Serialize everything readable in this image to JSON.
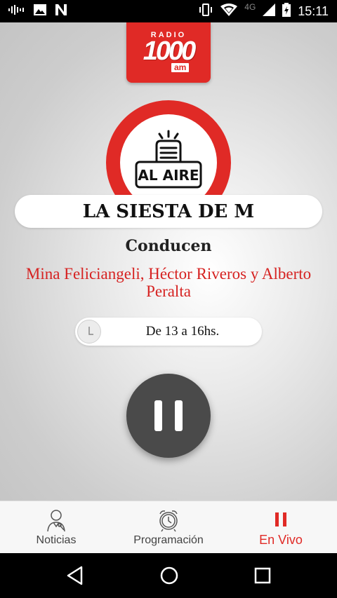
{
  "status_bar": {
    "time": "15:11",
    "network": "4G",
    "icons": [
      "equalizer-icon",
      "image-icon",
      "n-app-icon",
      "vibrate-icon",
      "wifi-icon",
      "signal-icon",
      "battery-charging-icon"
    ]
  },
  "logo": {
    "radio": "RADIO",
    "number": "1000",
    "band": "am"
  },
  "onair": {
    "label": "AL AIRE"
  },
  "program": {
    "title": "LA SIESTA DE M",
    "conducen_label": "Conducen",
    "hosts": "Mina Feliciangeli, Héctor Riveros y Alberto Peralta",
    "schedule": "De 13 a 16hs."
  },
  "player": {
    "state": "playing",
    "control_icon": "pause-icon"
  },
  "bottom_nav": {
    "items": [
      {
        "label": "Noticias",
        "icon": "reporter-icon",
        "active": false
      },
      {
        "label": "Programación",
        "icon": "alarm-clock-icon",
        "active": false
      },
      {
        "label": "En Vivo",
        "icon": "pause-icon",
        "active": true
      }
    ]
  },
  "colors": {
    "brand_red": "#e02a26",
    "player_dark": "#4a4a4a"
  }
}
